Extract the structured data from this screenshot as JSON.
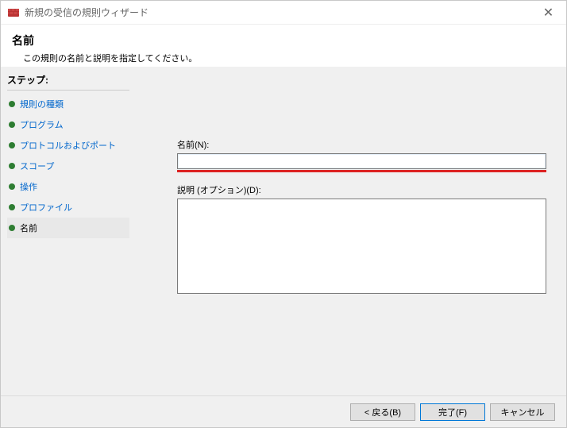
{
  "window": {
    "title": "新規の受信の規則ウィザード"
  },
  "header": {
    "title": "名前",
    "subtitle": "この規則の名前と説明を指定してください。"
  },
  "sidebar": {
    "steps_label": "ステップ:",
    "items": [
      {
        "label": "規則の種類"
      },
      {
        "label": "プログラム"
      },
      {
        "label": "プロトコルおよびポート"
      },
      {
        "label": "スコープ"
      },
      {
        "label": "操作"
      },
      {
        "label": "プロファイル"
      },
      {
        "label": "名前"
      }
    ],
    "current_index": 6
  },
  "form": {
    "name_label": "名前(N):",
    "name_value": "",
    "desc_label": "説明 (オプション)(D):",
    "desc_value": ""
  },
  "buttons": {
    "back": "< 戻る(B)",
    "finish": "完了(F)",
    "cancel": "キャンセル"
  }
}
